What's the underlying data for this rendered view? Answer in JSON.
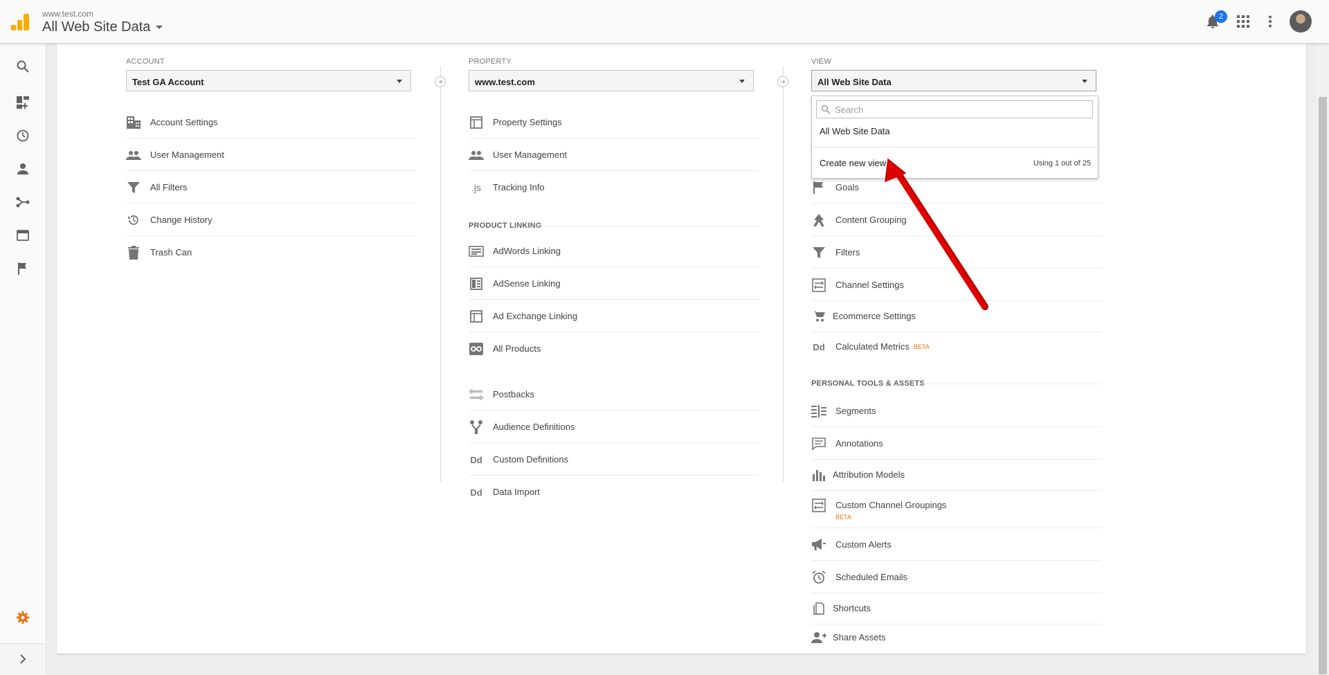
{
  "header": {
    "site_url": "www.test.com",
    "view_title": "All Web Site Data",
    "notification_count": "2"
  },
  "columns": {
    "account": {
      "label": "ACCOUNT",
      "selected": "Test GA Account",
      "items": [
        {
          "label": "Account Settings",
          "icon": "building-icon"
        },
        {
          "label": "User Management",
          "icon": "people-icon"
        },
        {
          "label": "All Filters",
          "icon": "filter-icon"
        },
        {
          "label": "Change History",
          "icon": "history-icon"
        },
        {
          "label": "Trash Can",
          "icon": "trash-icon"
        }
      ]
    },
    "property": {
      "label": "PROPERTY",
      "selected": "www.test.com",
      "items": [
        {
          "label": "Property Settings",
          "icon": "layout-icon"
        },
        {
          "label": "User Management",
          "icon": "people-icon"
        },
        {
          "label": "Tracking Info",
          "icon": "js-icon"
        }
      ],
      "product_linking_title": "PRODUCT LINKING",
      "linking_items": [
        {
          "label": "AdWords Linking",
          "icon": "adwords-icon"
        },
        {
          "label": "AdSense Linking",
          "icon": "adsense-icon"
        },
        {
          "label": "Ad Exchange Linking",
          "icon": "adexchange-icon"
        },
        {
          "label": "All Products",
          "icon": "products-icon"
        }
      ],
      "other_items": [
        {
          "label": "Postbacks",
          "icon": "postbacks-icon"
        },
        {
          "label": "Audience Definitions",
          "icon": "audience-icon"
        },
        {
          "label": "Custom Definitions",
          "icon": "dd-icon"
        },
        {
          "label": "Data Import",
          "icon": "dd-icon"
        }
      ]
    },
    "view": {
      "label": "VIEW",
      "selected": "All Web Site Data",
      "items": [
        {
          "label": "Goals",
          "icon": "flag-icon"
        },
        {
          "label": "Content Grouping",
          "icon": "content-grouping-icon"
        },
        {
          "label": "Filters",
          "icon": "filter-icon"
        },
        {
          "label": "Channel Settings",
          "icon": "channel-icon"
        },
        {
          "label": "Ecommerce Settings",
          "icon": "cart-icon"
        },
        {
          "label": "Calculated Metrics",
          "icon": "dd-icon",
          "beta": "BETA"
        }
      ],
      "personal_title": "PERSONAL TOOLS & ASSETS",
      "personal_items": [
        {
          "label": "Segments",
          "icon": "segments-icon"
        },
        {
          "label": "Annotations",
          "icon": "annotation-icon"
        },
        {
          "label": "Attribution Models",
          "icon": "bar-chart-icon"
        },
        {
          "label": "Custom Channel Groupings",
          "icon": "channel-icon",
          "beta": "BETA"
        },
        {
          "label": "Custom Alerts",
          "icon": "megaphone-icon"
        },
        {
          "label": "Scheduled Emails",
          "icon": "alarm-icon"
        },
        {
          "label": "Shortcuts",
          "icon": "shortcut-icon"
        },
        {
          "label": "Share Assets",
          "icon": "share-person-icon"
        }
      ]
    }
  },
  "dropdown": {
    "search_placeholder": "Search",
    "option": "All Web Site Data",
    "create_label": "Create new view",
    "usage": "Using 1 out of 25"
  },
  "colors": {
    "accent_orange": "#e8710a",
    "arrow_red": "#e00000",
    "logo_yellow": "#f9ab00",
    "badge_blue": "#1a73e8"
  }
}
